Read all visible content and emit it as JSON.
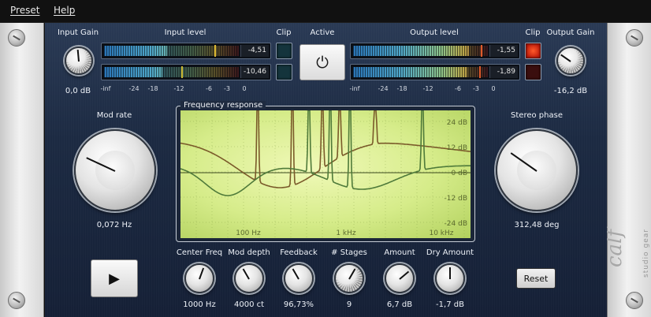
{
  "menu": {
    "preset": "Preset",
    "help": "Help"
  },
  "input_gain": {
    "label": "Input Gain",
    "value": "0,0 dB"
  },
  "input_level": {
    "label": "Input level",
    "left_value": "-4,51",
    "right_value": "-10,46",
    "left_fill": 0.47,
    "right_fill": 0.43,
    "scale": [
      "-inf",
      "-24",
      "-18",
      "-12",
      "-6",
      "-3",
      "0"
    ]
  },
  "clip_in_label": "Clip",
  "active_label": "Active",
  "output_level": {
    "label": "Output level",
    "left_value": "-1,55",
    "right_value": "-1,89",
    "left_fill": 0.86,
    "right_fill": 0.85,
    "scale": [
      "-inf",
      "-24",
      "-18",
      "-12",
      "-6",
      "-3",
      "0"
    ]
  },
  "clip_out_label": "Clip",
  "output_gain": {
    "label": "Output Gain",
    "value": "-16,2 dB"
  },
  "mod_rate": {
    "label": "Mod rate",
    "value": "0,072 Hz"
  },
  "stereo_phase": {
    "label": "Stereo phase",
    "value": "312,48 deg"
  },
  "graph": {
    "title": "Frequency response",
    "y_labels": [
      "24 dB",
      "12 dB",
      "0 dB",
      "-12 dB",
      "-24 dB"
    ],
    "x_labels": [
      "100 Hz",
      "1 kHz",
      "10 kHz"
    ]
  },
  "knobs": [
    {
      "label": "Center Freq",
      "value": "1000 Hz"
    },
    {
      "label": "Mod depth",
      "value": "4000 ct"
    },
    {
      "label": "Feedback",
      "value": "96,73%"
    },
    {
      "label": "# Stages",
      "value": "9"
    },
    {
      "label": "Amount",
      "value": "6,7 dB"
    },
    {
      "label": "Dry Amount",
      "value": "-1,7 dB"
    }
  ],
  "reset_label": "Reset",
  "colors": {
    "panel": "#1c2a42",
    "graph_bg": "#d6ec8a",
    "curve_a": "#7a5a2a",
    "curve_b": "#4f7a3a",
    "clip_on": "#e2381a"
  },
  "icons": {
    "play": "play-icon",
    "power": "power-icon",
    "screw": "screw-icon"
  },
  "branding": {
    "logo": "calf",
    "sub": "studio gear"
  }
}
